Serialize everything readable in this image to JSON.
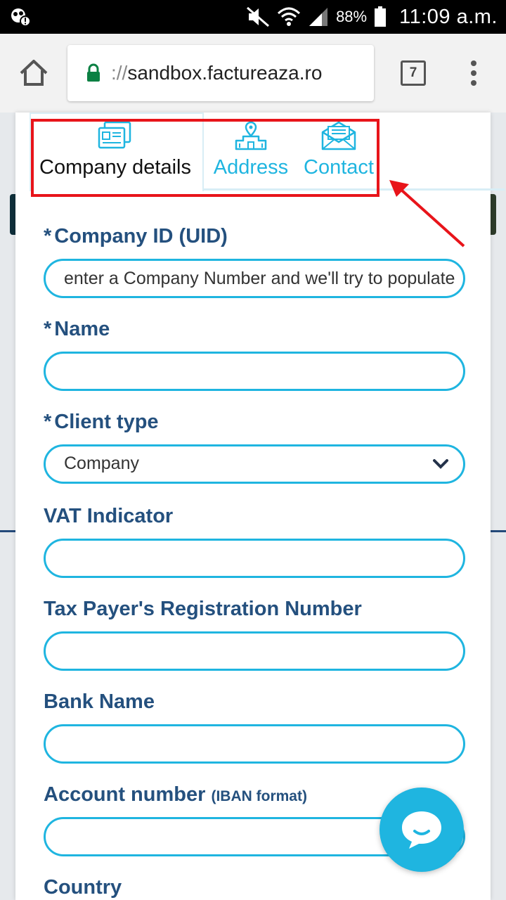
{
  "status_bar": {
    "battery_percent": "88%",
    "time": "11:09 a.m."
  },
  "browser": {
    "url_scheme": "://",
    "url_host": "sandbox.factureaza.ro",
    "tab_count": "7"
  },
  "tabs": [
    {
      "label": "Company details",
      "icon": "company-card-icon",
      "active": true
    },
    {
      "label": "Address",
      "icon": "building-location-icon",
      "active": false
    },
    {
      "label": "Contact",
      "icon": "envelope-icon",
      "active": false
    }
  ],
  "form": {
    "required_marker": "*",
    "company_id": {
      "label": "Company ID (UID)",
      "placeholder": "enter a Company Number and we'll try to populate"
    },
    "name": {
      "label": "Name",
      "value": ""
    },
    "client_type": {
      "label": "Client type",
      "value": "Company"
    },
    "vat_indicator": {
      "label": "VAT Indicator",
      "value": ""
    },
    "tax_reg_number": {
      "label": "Tax Payer's Registration Number",
      "value": ""
    },
    "bank_name": {
      "label": "Bank Name",
      "value": ""
    },
    "account_number": {
      "label": "Account number",
      "hint": "(IBAN format)",
      "value": ""
    },
    "country": {
      "label": "Country"
    }
  },
  "colors": {
    "accent": "#1fb5e0",
    "label": "#24507e",
    "highlight": "#e8141a"
  }
}
